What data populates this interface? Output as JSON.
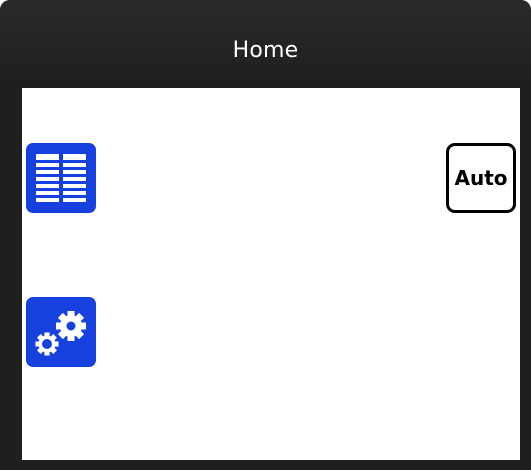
{
  "header": {
    "title": "Home"
  },
  "tiles": [
    {
      "name": "list",
      "icon": "list-grid-icon"
    },
    {
      "name": "settings",
      "icon": "gears-icon"
    }
  ],
  "auto_button": {
    "label": "Auto"
  },
  "colors": {
    "header_bg": "#1f1f1f",
    "tile_blue": "#1741de",
    "content_bg": "#ffffff",
    "title_text": "#ffffff",
    "button_border": "#000000"
  }
}
